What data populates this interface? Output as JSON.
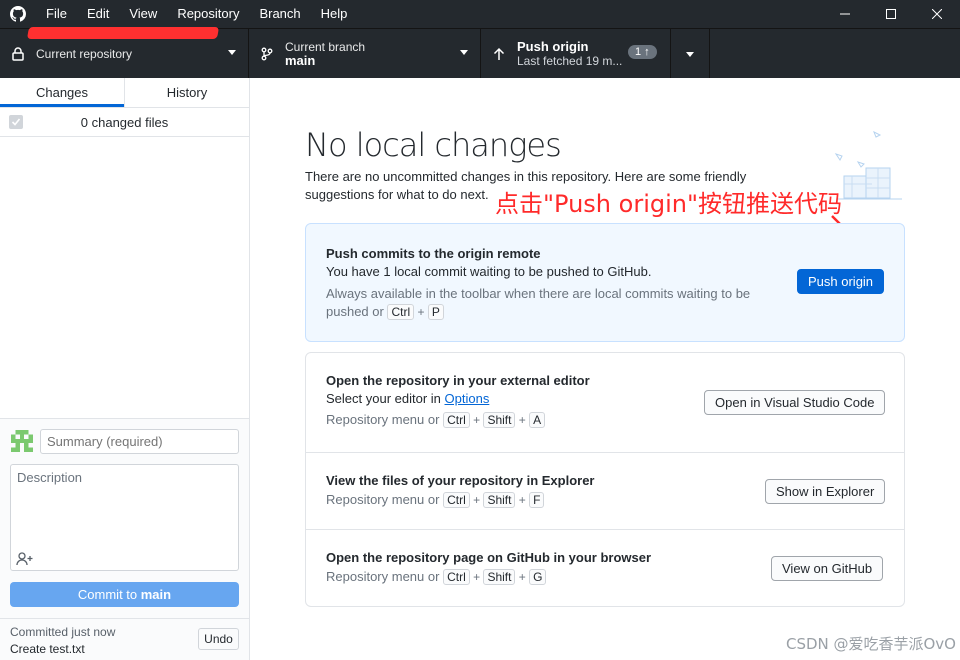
{
  "menu": [
    "File",
    "Edit",
    "View",
    "Repository",
    "Branch",
    "Help"
  ],
  "toolbar": {
    "repo_label": "Current repository",
    "branch_label": "Current branch",
    "branch_value": "main",
    "push_title": "Push origin",
    "push_sub": "Last fetched 19 m...",
    "push_badge": "1 ↑"
  },
  "sidebar": {
    "tab_changes": "Changes",
    "tab_history": "History",
    "changed_files": "0 changed files",
    "summary_placeholder": "Summary (required)",
    "description_placeholder": "Description",
    "commit_prefix": "Commit to ",
    "commit_branch": "main",
    "last_commit_time": "Committed just now",
    "last_commit_msg": "Create test.txt",
    "undo": "Undo"
  },
  "main": {
    "heading": "No local changes",
    "intro": "There are no uncommitted changes in this repository. Here are some friendly suggestions for what to do next.",
    "annotation": "点击\"Push origin\"按钮推送代码",
    "push_card": {
      "title": "Push commits to the origin remote",
      "desc": "You have 1 local commit waiting to be pushed to GitHub.",
      "hint": "Always available in the toolbar when there are local commits waiting to be pushed or",
      "keys": [
        "Ctrl",
        "P"
      ],
      "button": "Push origin"
    },
    "editor_card": {
      "title": "Open the repository in your external editor",
      "desc_prefix": "Select your editor in ",
      "desc_link": "Options",
      "hint": "Repository menu or",
      "keys": [
        "Ctrl",
        "Shift",
        "A"
      ],
      "button": "Open in Visual Studio Code"
    },
    "explorer_card": {
      "title": "View the files of your repository in Explorer",
      "hint": "Repository menu or",
      "keys": [
        "Ctrl",
        "Shift",
        "F"
      ],
      "button": "Show in Explorer"
    },
    "github_card": {
      "title": "Open the repository page on GitHub in your browser",
      "hint": "Repository menu or",
      "keys": [
        "Ctrl",
        "Shift",
        "G"
      ],
      "button": "View on GitHub"
    }
  },
  "watermark": "CSDN @爱吃香芋派OvO",
  "colors": {
    "accent": "#0366d6",
    "toolbar": "#24292e",
    "annotation": "#ff2a2a"
  }
}
